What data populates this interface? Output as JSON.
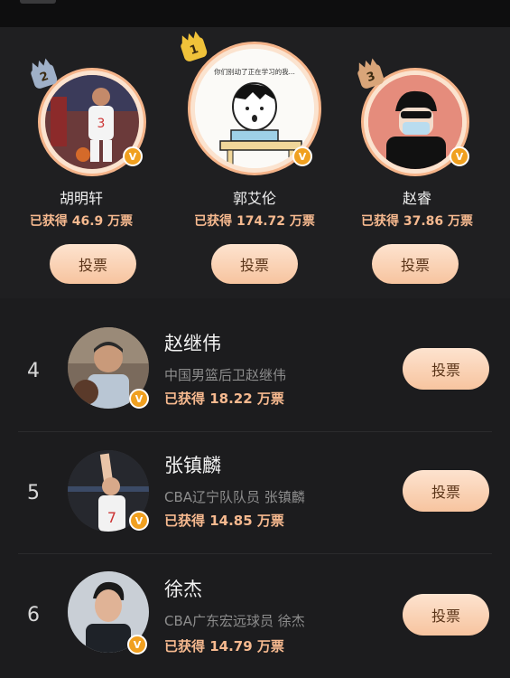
{
  "top3": [
    {
      "rank": "2",
      "name": "胡明轩",
      "votes": "已获得 46.9 万票",
      "vote_label": "投票",
      "badge_color": "#9fb0c8"
    },
    {
      "rank": "1",
      "name": "郭艾伦",
      "votes": "已获得 174.72 万票",
      "vote_label": "投票",
      "badge_color": "#f0c23a",
      "bubble_text": "你们别动了正在学习的我..."
    },
    {
      "rank": "3",
      "name": "赵睿",
      "votes": "已获得 37.86 万票",
      "vote_label": "投票",
      "badge_color": "#d9a579"
    }
  ],
  "list": [
    {
      "rank": "4",
      "name": "赵继伟",
      "desc": "中国男篮后卫赵继伟",
      "votes": "已获得 18.22 万票",
      "vote_label": "投票"
    },
    {
      "rank": "5",
      "name": "张镇麟",
      "desc": "CBA辽宁队队员 张镇麟",
      "votes": "已获得 14.85 万票",
      "vote_label": "投票",
      "jersey_number": "7"
    },
    {
      "rank": "6",
      "name": "徐杰",
      "desc": "CBA广东宏远球员 徐杰",
      "votes": "已获得 14.79 万票",
      "vote_label": "投票"
    }
  ],
  "verified_mark": "V",
  "jersey_left": "3",
  "colors": {
    "accent": "#f6b98f",
    "button": "#f7c49f",
    "background": "#1c1c1e"
  }
}
